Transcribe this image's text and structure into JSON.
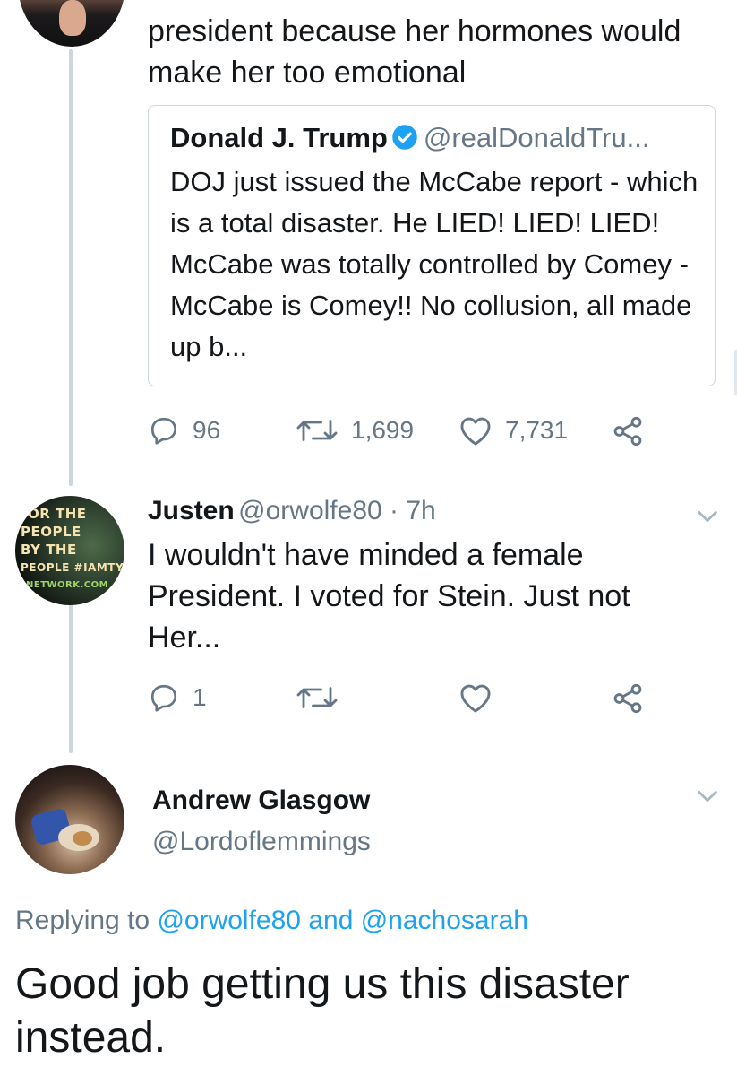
{
  "tweet1": {
    "text": "president because her hormones would make her too emotional",
    "quote": {
      "name": "Donald J. Trump",
      "handle": "@realDonaldTru...",
      "text": "DOJ just issued the McCabe report - which is a total disaster. He LIED! LIED! LIED! McCabe was totally controlled by Comey - McCabe is Comey!! No collusion, all made up b..."
    },
    "replies": "96",
    "retweets": "1,699",
    "likes": "7,731"
  },
  "tweet2": {
    "name": "Justen",
    "handle_time": "@orwolfe80 · 7h",
    "text": "I wouldn't have minded a female President. I voted for Stein. Just not Her...",
    "avatar_text": [
      "OR THE",
      "PEOPLE",
      "BY THE",
      "PEOPLE #IAMTYT",
      "NETWORK.COM"
    ],
    "replies": "1",
    "retweets": "",
    "likes": ""
  },
  "tweet3": {
    "name": "Andrew Glasgow",
    "handle": "@Lordoflemmings",
    "replying_prefix": "Replying to ",
    "replying_user1": "@orwolfe80",
    "replying_and": " and ",
    "replying_user2": "@nachosarah",
    "text": "Good job getting us this disaster instead."
  },
  "colors": {
    "text": "#14171a",
    "secondary": "#657786",
    "link": "#1da1f2",
    "border": "#ccd6dd"
  },
  "icons": [
    "reply-icon",
    "retweet-icon",
    "like-icon",
    "share-icon",
    "chevron-down-icon",
    "verified-icon"
  ]
}
